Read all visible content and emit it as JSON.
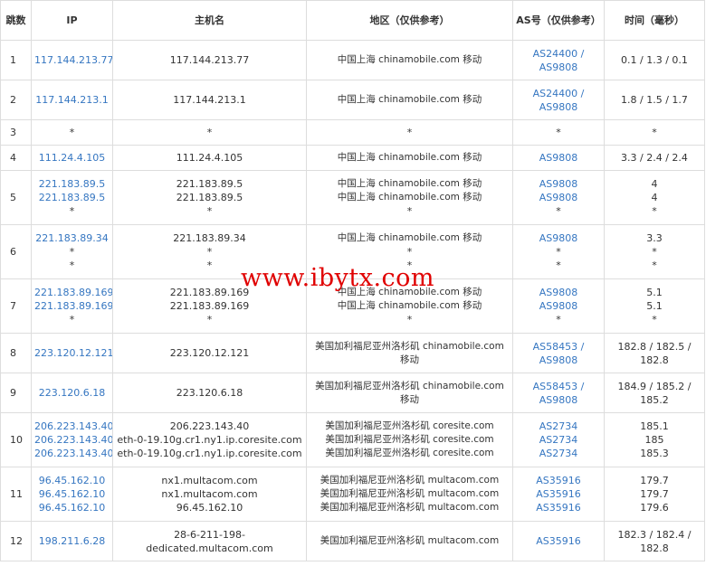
{
  "headers": {
    "hop": "跳数",
    "ip": "IP",
    "host": "主机名",
    "region": "地区（仅供参考）",
    "as": "AS号（仅供参考）",
    "time": "时间（毫秒）"
  },
  "rows": [
    {
      "hop": "1",
      "ips": [
        "117.144.213.77"
      ],
      "hosts": [
        "117.144.213.77"
      ],
      "regions": [
        "中国上海 chinamobile.com 移动"
      ],
      "as": [
        "AS24400 /",
        "AS9808"
      ],
      "times": [
        "0.1 / 1.3 / 0.1"
      ]
    },
    {
      "hop": "2",
      "ips": [
        "117.144.213.1"
      ],
      "hosts": [
        "117.144.213.1"
      ],
      "regions": [
        "中国上海 chinamobile.com 移动"
      ],
      "as": [
        "AS24400 /",
        "AS9808"
      ],
      "times": [
        "1.8 / 1.5 / 1.7"
      ]
    },
    {
      "hop": "3",
      "ips": [
        "*"
      ],
      "hosts": [
        "*"
      ],
      "regions": [
        "*"
      ],
      "as": [
        "*"
      ],
      "times": [
        "*"
      ]
    },
    {
      "hop": "4",
      "ips": [
        "111.24.4.105"
      ],
      "hosts": [
        "111.24.4.105"
      ],
      "regions": [
        "中国上海 chinamobile.com 移动"
      ],
      "as": [
        "AS9808"
      ],
      "times": [
        "3.3 / 2.4 / 2.4"
      ]
    },
    {
      "hop": "5",
      "ips": [
        "221.183.89.5",
        "221.183.89.5",
        "*"
      ],
      "hosts": [
        "221.183.89.5",
        "221.183.89.5",
        "*"
      ],
      "regions": [
        "中国上海 chinamobile.com 移动",
        "中国上海 chinamobile.com 移动",
        "*"
      ],
      "as": [
        "AS9808",
        "AS9808",
        "*"
      ],
      "times": [
        "4",
        "4",
        "*"
      ]
    },
    {
      "hop": "6",
      "ips": [
        "221.183.89.34",
        "*",
        "*"
      ],
      "hosts": [
        "221.183.89.34",
        "*",
        "*"
      ],
      "regions": [
        "中国上海 chinamobile.com 移动",
        "*",
        "*"
      ],
      "as": [
        "AS9808",
        "*",
        "*"
      ],
      "times": [
        "3.3",
        "*",
        "*"
      ]
    },
    {
      "hop": "7",
      "ips": [
        "221.183.89.169",
        "221.183.89.169",
        "*"
      ],
      "hosts": [
        "221.183.89.169",
        "221.183.89.169",
        "*"
      ],
      "regions": [
        "中国上海 chinamobile.com 移动",
        "中国上海 chinamobile.com 移动",
        "*"
      ],
      "as": [
        "AS9808",
        "AS9808",
        "*"
      ],
      "times": [
        "5.1",
        "5.1",
        "*"
      ]
    },
    {
      "hop": "8",
      "ips": [
        "223.120.12.121"
      ],
      "hosts": [
        "223.120.12.121"
      ],
      "regions": [
        "美国加利福尼亚州洛杉矶 chinamobile.com",
        "移动"
      ],
      "as": [
        "AS58453 /",
        "AS9808"
      ],
      "times": [
        "182.8 / 182.5 /",
        "182.8"
      ]
    },
    {
      "hop": "9",
      "ips": [
        "223.120.6.18"
      ],
      "hosts": [
        "223.120.6.18"
      ],
      "regions": [
        "美国加利福尼亚州洛杉矶 chinamobile.com",
        "移动"
      ],
      "as": [
        "AS58453 /",
        "AS9808"
      ],
      "times": [
        "184.9 / 185.2 /",
        "185.2"
      ]
    },
    {
      "hop": "10",
      "ips": [
        "206.223.143.40",
        "206.223.143.40",
        "206.223.143.40"
      ],
      "hosts": [
        "206.223.143.40",
        "eth-0-19.10g.cr1.ny1.ip.coresite.com",
        "eth-0-19.10g.cr1.ny1.ip.coresite.com"
      ],
      "regions": [
        "美国加利福尼亚州洛杉矶 coresite.com",
        "美国加利福尼亚州洛杉矶 coresite.com",
        "美国加利福尼亚州洛杉矶 coresite.com"
      ],
      "as": [
        "AS2734",
        "AS2734",
        "AS2734"
      ],
      "times": [
        "185.1",
        "185",
        "185.3"
      ]
    },
    {
      "hop": "11",
      "ips": [
        "96.45.162.10",
        "96.45.162.10",
        "96.45.162.10"
      ],
      "hosts": [
        "nx1.multacom.com",
        "nx1.multacom.com",
        "96.45.162.10"
      ],
      "regions": [
        "美国加利福尼亚州洛杉矶 multacom.com",
        "美国加利福尼亚州洛杉矶 multacom.com",
        "美国加利福尼亚州洛杉矶 multacom.com"
      ],
      "as": [
        "AS35916",
        "AS35916",
        "AS35916"
      ],
      "times": [
        "179.7",
        "179.7",
        "179.6"
      ]
    },
    {
      "hop": "12",
      "ips": [
        "198.211.6.28"
      ],
      "hosts": [
        "28-6-211-198-",
        "dedicated.multacom.com"
      ],
      "regions": [
        "美国加利福尼亚州洛杉矶 multacom.com"
      ],
      "as": [
        "AS35916"
      ],
      "times": [
        "182.3 / 182.4 /",
        "182.8"
      ]
    }
  ],
  "watermark": "www.ibytx.com"
}
